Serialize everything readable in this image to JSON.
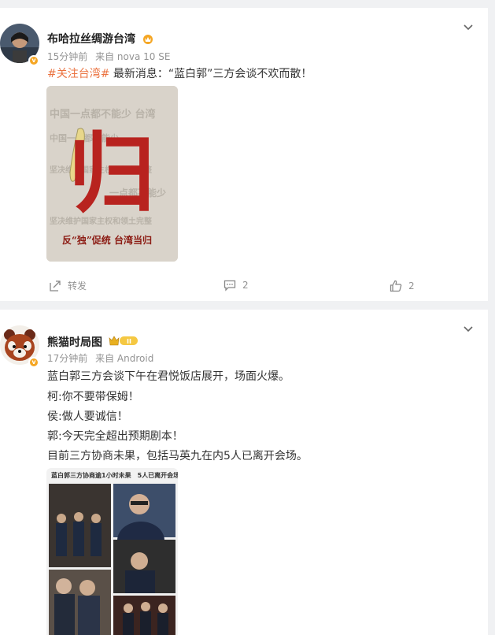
{
  "post1": {
    "username": "布哈拉丝绸游台湾",
    "time": "15分钟前",
    "source": "来自 nova 10 SE",
    "topic": "#关注台湾#",
    "body": " 最新消息：“蓝白郭”三方会谈不欢而散！",
    "image": {
      "big_char": "归",
      "bottom_line": "反“独”促统 台湾当归",
      "bg_words": [
        "中国一点都不能少",
        "中国一点都不能少 台湾",
        "坚决维护国家主权和领土完整",
        "一点都不能少"
      ]
    },
    "actions": {
      "repost_label": "转发",
      "comment_count": "2",
      "like_count": "2"
    }
  },
  "post2": {
    "username": "熊猫时局图",
    "level_badge": "II",
    "time": "17分钟前",
    "source": "来自 Android",
    "lines": [
      "蓝白郭三方会谈下午在君悦饭店展开，场面火爆。",
      "柯:你不要带保姆！",
      "侯:做人要诚信！",
      "郭:今天完全超出预期剧本！",
      "目前三方协商未果，包括马英九在内5人已离开会场。"
    ],
    "image_caption": "蓝白郭三方协商逾1小时未果　5人已离开会场"
  },
  "colors": {
    "topic": "#eb7340",
    "meta": "#939393",
    "badge": "#f5a623",
    "red_char": "#b8231f"
  }
}
